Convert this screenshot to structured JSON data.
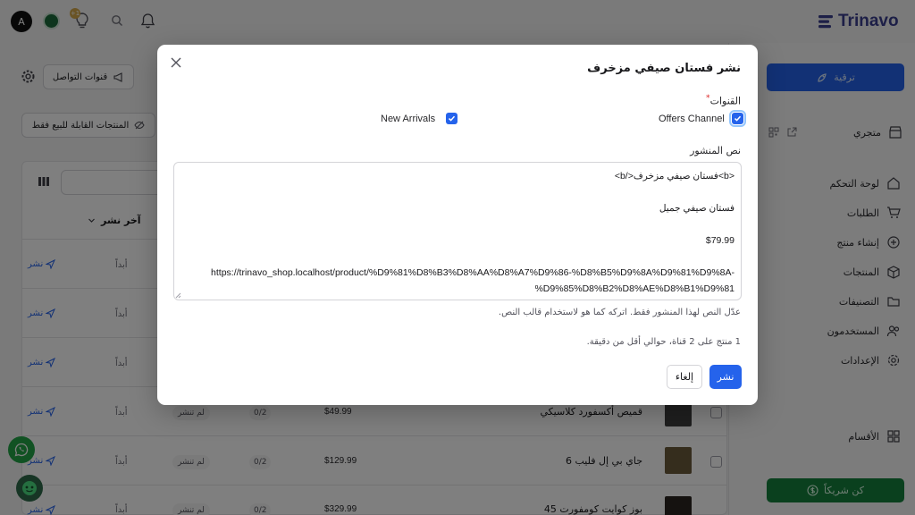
{
  "header": {
    "avatar_letter": "A",
    "notification_count": "+1",
    "logo_text": "Trinavo"
  },
  "sidebar": {
    "upgrade_label": "ترقية",
    "store_label": "متجري",
    "items": [
      {
        "label": "لوحة التحكم",
        "icon": "home-icon"
      },
      {
        "label": "الطلبات",
        "icon": "cart-icon"
      },
      {
        "label": "إنشاء منتج",
        "icon": "plus-circle-icon"
      },
      {
        "label": "المنتجات",
        "icon": "box-icon"
      },
      {
        "label": "التصنيفات",
        "icon": "folder-icon"
      },
      {
        "label": "المستخدمون",
        "icon": "users-icon"
      },
      {
        "label": "الإعدادات",
        "icon": "settings-icon"
      }
    ],
    "sections_label": "الأقسام",
    "partner_label": "كن شريكاً"
  },
  "main": {
    "channels_button": "قنوات التواصل",
    "filter_chip": "المنتجات القابلة للبيع فقط",
    "last_post_header": "آخر نشر",
    "rows": [
      {
        "publish": "نشر",
        "last": "أبداً"
      },
      {
        "publish": "نشر",
        "last": "أبداً"
      },
      {
        "publish": "نشر",
        "last": "أبداً"
      },
      {
        "publish": "نشر",
        "last": "أبداً",
        "status": "لم تنشر",
        "ratio": "0/2",
        "price": "$49.99",
        "name": "قميص أكسفورد كلاسيكي"
      },
      {
        "publish": "نشر",
        "last": "أبداً",
        "status": "لم تنشر",
        "ratio": "0/2",
        "price": "$129.99",
        "name": "جاي بي إل فليب 6"
      },
      {
        "publish": "نشر",
        "last": "أبداً",
        "status": "لم تنشر",
        "ratio": "0/2",
        "price": "$329.99",
        "name": "بوز كوايت كومفورت 45"
      }
    ]
  },
  "modal": {
    "title": "نشر فستان صيفي مزخرف",
    "channels_label": "القنوات",
    "required_mark": "*",
    "channels": [
      {
        "label": "Offers Channel",
        "checked": true
      },
      {
        "label": "New Arrivals",
        "checked": true
      }
    ],
    "post_text_label": "نص المنشور",
    "post_lines": [
      "<b>فستان صيفي مزخرف</b>",
      "",
      "فستان صيفي جميل",
      "",
      "$79.99",
      "",
      "https://trinavo_shop.localhost/product/%D9%81%D8%B3%D8%AA%D8%A7%D9%86-%D8%B5%D9%8A%D9%81%D9%8A-",
      "%D9%85%D8%B2%D8%AE%D8%B1%D9%81"
    ],
    "hint": "عدّل النص لهذا المنشور فقط. اتركه كما هو لاستخدام قالب النص.",
    "summary": "1 منتج على 2 قناة، حوالي أقل من دقيقة.",
    "publish_button": "نشر",
    "cancel_button": "إلغاء"
  }
}
